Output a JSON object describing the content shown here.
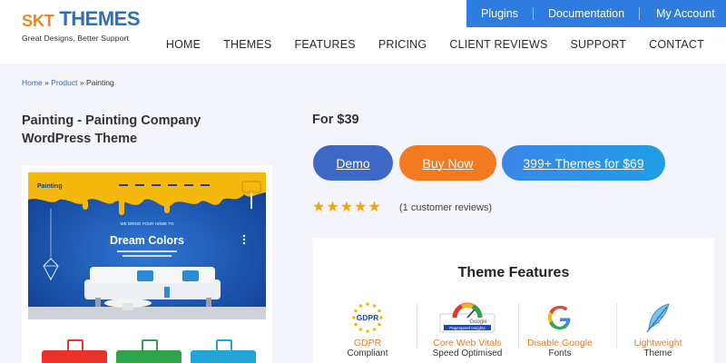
{
  "logo": {
    "skt": "SKT",
    "themes": "THEMES",
    "tagline": "Great Designs, Better Support"
  },
  "topbar": {
    "plugins": "Plugins",
    "documentation": "Documentation",
    "account": "My Account"
  },
  "nav": {
    "home": "HOME",
    "themes": "THEMES",
    "features": "FEATURES",
    "pricing": "PRICING",
    "reviews": "CLIENT REVIEWS",
    "support": "SUPPORT",
    "contact": "CONTACT"
  },
  "breadcrumb": {
    "home": "Home",
    "sep": "»",
    "product": "Product",
    "current": "Painting"
  },
  "product": {
    "title": "Painting - Painting Company WordPress Theme",
    "price": "For $39",
    "rating": 5,
    "reviews": "(1 customer reviews)"
  },
  "buttons": {
    "demo": "Demo",
    "buy": "Buy Now",
    "bundle": "399+ Themes for $69"
  },
  "preview": {
    "brand": "Painting",
    "tagline": "WE BRING YOUR HOME TO",
    "headline": "Dream Colors"
  },
  "features": {
    "title": "Theme Features",
    "items": [
      {
        "label": "GDPR",
        "sub": "Compliant",
        "icon": "gdpr-icon"
      },
      {
        "label": "Core Web Vitals",
        "sub": "Speed Optimised",
        "icon": "pagespeed-gauge-icon"
      },
      {
        "label": "Disable Google",
        "sub": "Fonts",
        "icon": "google-icon"
      },
      {
        "label": "Lightweight",
        "sub": "Theme",
        "icon": "feather-icon"
      }
    ]
  },
  "colors": {
    "accent_blue": "#2f7ce0",
    "orange": "#f47a21",
    "demo_blue": "#3d68c6",
    "star": "#f3a314"
  }
}
